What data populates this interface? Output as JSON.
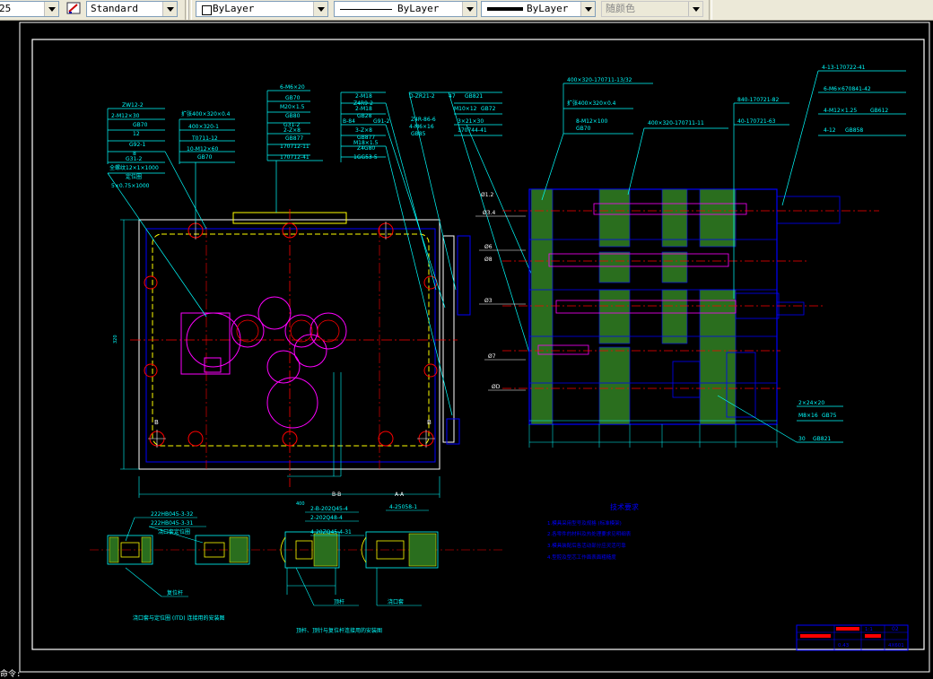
{
  "toolbar": {
    "scale_value": "25",
    "text_style": "Standard",
    "layer_color": "ByLayer",
    "linetype": "ByLayer",
    "lineweight": "ByLayer",
    "plot_style": "随颜色"
  },
  "sheet": {
    "section_bb": "B-B",
    "section_aa": "A-A",
    "tech_title": "技术要求",
    "tech_lines": [
      "1.模具采用型号及规格 (标准模架)",
      "2.各零件的材料及热处理要求见明细表",
      "3.模具装配后各活动部分应灵活可靠",
      "4.型腔及型芯工作面表面粗糙度"
    ],
    "bottom_notes": [
      "浇口套与定位圈 (ITD) 连接用的安装图",
      "顶杆、顶针与复位杆连接用的安装图"
    ],
    "command_prompt": "命令:"
  },
  "callouts_left": [
    "ZW12-2",
    "2-M12×30",
    "GB70",
    "12",
    "G92-1",
    "8",
    "G31-2",
    "全螺纹12×1×1000",
    "定位圈",
    "5×0.75×1000"
  ],
  "callouts_mid": [
    "扩张400×320×0.4",
    "400×320-1",
    "T0711-12",
    "10-M12×60",
    "GB70"
  ],
  "callouts_center": [
    "6-M6×20",
    "GB70",
    "M20×1.5",
    "GB80",
    "G31-2",
    "2-Z×8",
    "GB877",
    "170712-11",
    "170712-41"
  ],
  "callouts_right_stack": [
    "2-M18",
    "Z4R9-2",
    "2-M18",
    "GB28",
    "3-Z×8",
    "GB877",
    "M18×1.5",
    "Z4G80",
    "1GG53-5"
  ],
  "callouts_top": [
    "D-ZR21-2",
    "47",
    "GB821",
    "Z4R-86-6",
    "M10×12",
    "GB72",
    "4-M6×16",
    "3×21×30",
    "GB85",
    "170744-41",
    "B-84",
    "G91-2"
  ],
  "callouts_section_right": [
    "400×320-170711-13/32",
    "扩张400×320×0.4",
    "8-M12×100",
    "GB70",
    "400×320-170711-11",
    "840-170721-82",
    "40-170721-63"
  ],
  "callouts_far_right": [
    "4-13-170722-41",
    "6-M6×670841-42",
    "4-M12×1.25",
    "GB612",
    "4-12",
    "GB858"
  ],
  "callouts_lower_right": [
    "2×24×20",
    "M8×16",
    "GB75",
    "30",
    "GB821"
  ],
  "callouts_bottom_views": [
    "222HB045-3-32",
    "222HB045-3-31",
    "2-B-202Q45-4",
    "2-202Q48-4",
    "4-20ZQ45-4-31",
    "4-25058-1",
    "浇口套",
    "定位圈",
    "复位杆",
    "顶杆"
  ],
  "title_block": {
    "scale": "1:1",
    "sheet": "02",
    "mark": "0.43",
    "code": "4X601"
  }
}
